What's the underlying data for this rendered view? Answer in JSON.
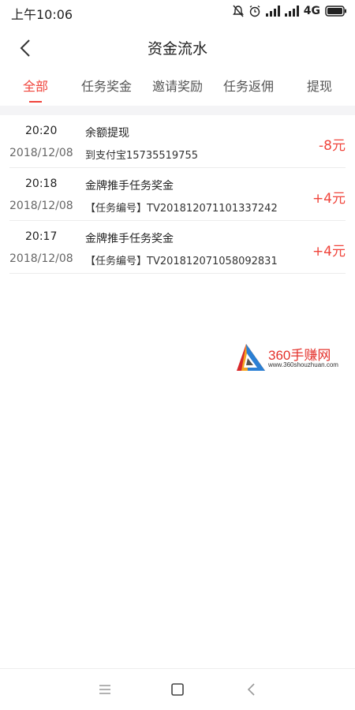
{
  "status_bar": {
    "time": "上午10:06",
    "network": "4G",
    "icons": [
      "mute-icon",
      "alarm-icon",
      "signal-icon",
      "hd-signal-icon",
      "battery-icon"
    ]
  },
  "header": {
    "title": "资金流水",
    "back_icon": "chevron-left-icon"
  },
  "tabs": [
    {
      "label": "全部",
      "active": true
    },
    {
      "label": "任务奖金",
      "active": false
    },
    {
      "label": "邀请奖励",
      "active": false
    },
    {
      "label": "任务返佣",
      "active": false
    },
    {
      "label": "提现",
      "active": false
    }
  ],
  "transactions": [
    {
      "time": "20:20",
      "date": "2018/12/08",
      "title": "余额提现",
      "detail": "到支付宝15735519755",
      "amount": "-8元"
    },
    {
      "time": "20:18",
      "date": "2018/12/08",
      "title": "金牌推手任务奖金",
      "detail": "【任务编号】TV201812071101337242",
      "amount": "+4元"
    },
    {
      "time": "20:17",
      "date": "2018/12/08",
      "title": "金牌推手任务奖金",
      "detail": "【任务编号】TV201812071058092831",
      "amount": "+4元"
    }
  ],
  "watermark": {
    "text": "360手赚网",
    "url": "www.360shouzhuan.com"
  },
  "colors": {
    "accent": "#f0443b",
    "text": "#222222",
    "muted": "#666666",
    "band": "#f4f4f6"
  },
  "nav": [
    "menu-icon",
    "home-square-icon",
    "back-triangle-icon"
  ]
}
